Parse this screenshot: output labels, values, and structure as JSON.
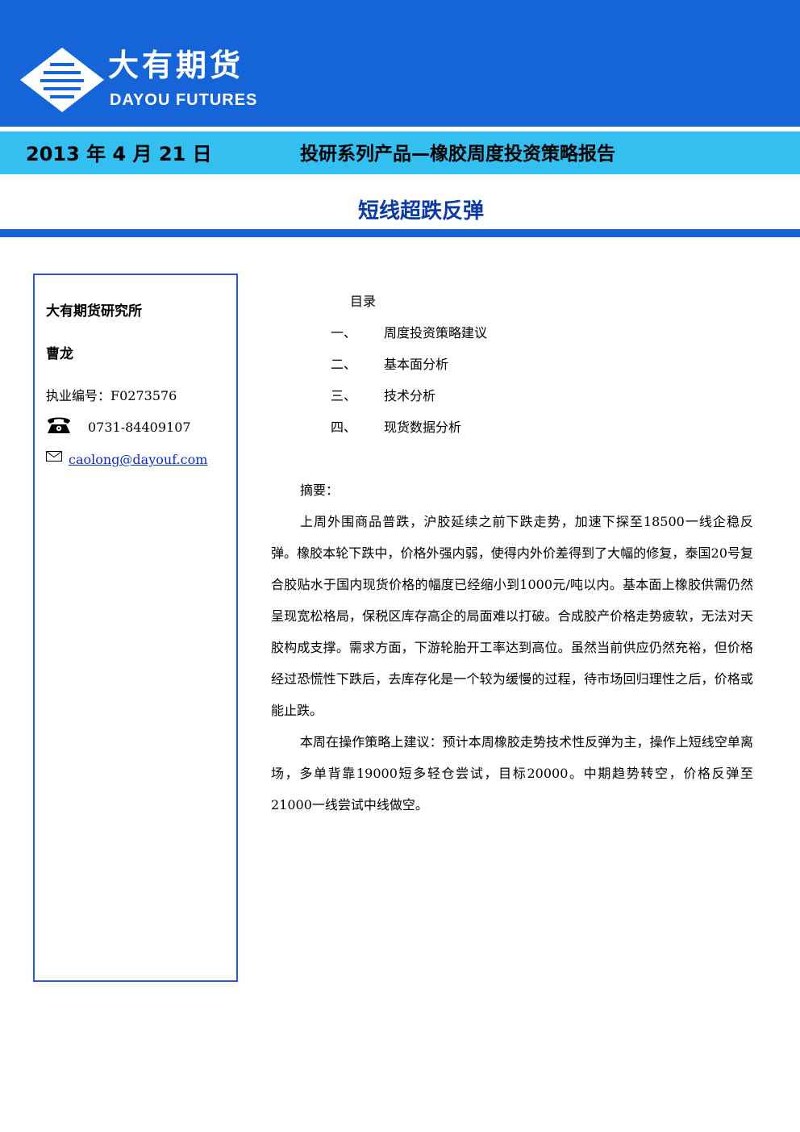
{
  "header": {
    "logo_cn": "大有期货",
    "logo_en": "DAYOU FUTURES",
    "date": "2013 年 4 月 21 日",
    "series_title": "投研系列产品—橡胶周度投资策略报告",
    "headline": "短线超跌反弹"
  },
  "sidebar": {
    "org": "大有期货研究所",
    "author": "曹龙",
    "license": "执业编号：F0273576",
    "phone": "0731-84409107",
    "email": "caolong@dayouf.com"
  },
  "toc": {
    "title": "目录",
    "items": [
      {
        "num": "一、",
        "label": "周度投资策略建议"
      },
      {
        "num": "二、",
        "label": "基本面分析"
      },
      {
        "num": "三、",
        "label": "技术分析"
      },
      {
        "num": "四、",
        "label": "现货数据分析"
      }
    ]
  },
  "summary": {
    "label": "摘要：",
    "paragraphs": [
      "上周外围商品普跌，沪胶延续之前下跌走势，加速下探至18500一线企稳反弹。橡胶本轮下跌中，价格外强内弱，使得内外价差得到了大幅的修复，泰国20号复合胶贴水于国内现货价格的幅度已经缩小到1000元/吨以内。基本面上橡胶供需仍然呈现宽松格局，保税区库存高企的局面难以打破。合成胶产价格走势疲软，无法对天胶构成支撑。需求方面，下游轮胎开工率达到高位。虽然当前供应仍然充裕，但价格经过恐慌性下跌后，去库存化是一个较为缓慢的过程，待市场回归理性之后，价格或能止跌。",
      "本周在操作策略上建议：预计本周橡胶走势技术性反弹为主，操作上短线空单离场，多单背靠19000短多轻仓尝试，目标20000。中期趋势转空，价格反弹至21000一线尝试中线做空。"
    ]
  },
  "colors": {
    "banner_blue": "#1565d8",
    "band_cyan": "#33bff0",
    "headline_blue": "#0b3aa7",
    "link_blue": "#0a2bd0"
  },
  "icons": [
    "dayou-logo-icon",
    "telephone-icon",
    "envelope-icon"
  ]
}
